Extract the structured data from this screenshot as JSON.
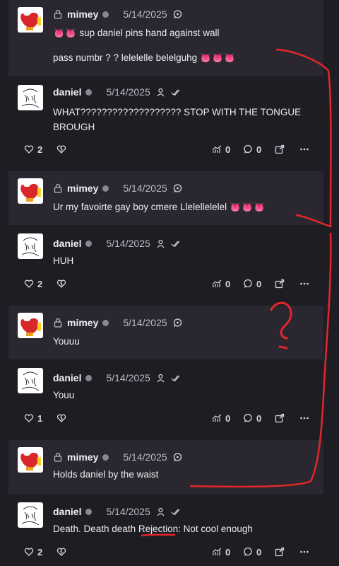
{
  "posts": [
    {
      "author": "mimey",
      "date": "5/14/2025",
      "line1": "👅👅 sup daniel pins hand against wall",
      "line2": "pass numbr ? ? lelelelle belelguhg 👅👅👅"
    },
    {
      "author": "daniel",
      "date": "5/14/2025",
      "line1": "WHAT??????????????????? STOP WITH THE TONGUE",
      "line2": "BROUGH",
      "likes": "2",
      "views": "0",
      "comments": "0"
    },
    {
      "author": "mimey",
      "date": "5/14/2025",
      "line1": "Ur my favoirte gay boy cmere Llelellelelel 👅👅👅"
    },
    {
      "author": "daniel",
      "date": "5/14/2025",
      "line1": "HUH",
      "likes": "2",
      "views": "0",
      "comments": "0"
    },
    {
      "author": "mimey",
      "date": "5/14/2025",
      "line1": "Youuu"
    },
    {
      "author": "daniel",
      "date": "5/14/2025",
      "line1": "Youu",
      "likes": "1",
      "views": "0",
      "comments": "0"
    },
    {
      "author": "mimey",
      "date": "5/14/2025",
      "line1": "Holds daniel by the waist"
    },
    {
      "author": "daniel",
      "date": "5/14/2025",
      "line1": "Death. Death death Rejection: Not cool enough",
      "likes": "2",
      "views": "0",
      "comments": "0"
    }
  ],
  "icons": {
    "lock": "lock-icon",
    "status_dot": "status-dot",
    "chat": "chat-bubble-icon",
    "person": "person-icon",
    "check": "double-check-icon",
    "heart": "heart-icon",
    "broken_heart": "broken-heart-icon",
    "stats": "stats-icon",
    "comment": "comment-icon",
    "share": "share-icon",
    "more": "more-icon"
  },
  "colors": {
    "mimey_bg": "#2a2730",
    "daniel_bg": "#1f1d24",
    "annotation_red": "#e3262a"
  }
}
